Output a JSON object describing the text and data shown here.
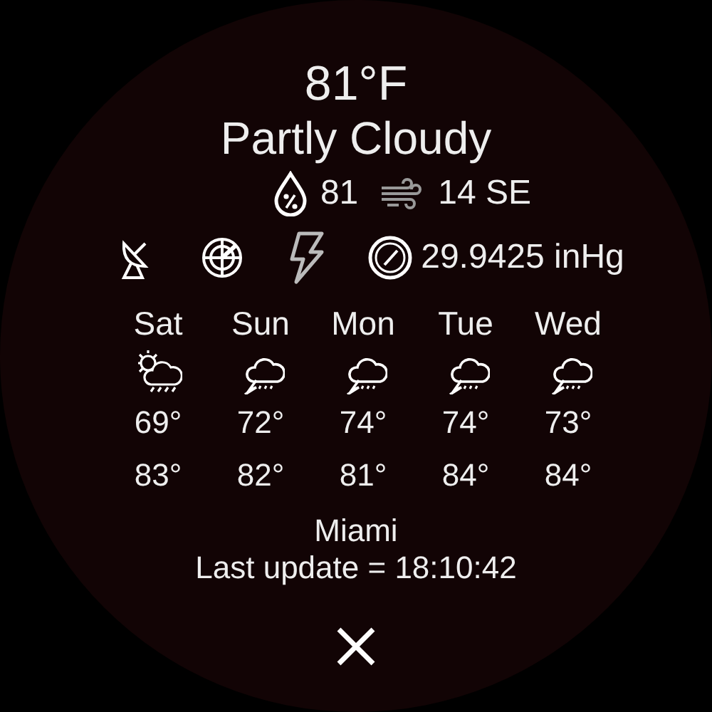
{
  "temperature": "81°F",
  "condition": "Partly Cloudy",
  "humidity": "81",
  "wind": "14 SE",
  "pressure": "29.9425 inHg",
  "forecast": [
    {
      "day": "Sat",
      "kind": "sun-rain",
      "low": "69°",
      "high": "83°"
    },
    {
      "day": "Sun",
      "kind": "storm",
      "low": "72°",
      "high": "82°"
    },
    {
      "day": "Mon",
      "kind": "storm",
      "low": "74°",
      "high": "81°"
    },
    {
      "day": "Tue",
      "kind": "storm",
      "low": "74°",
      "high": "84°"
    },
    {
      "day": "Wed",
      "kind": "storm",
      "low": "73°",
      "high": "84°"
    }
  ],
  "location": "Miami",
  "last_update": "Last update = 18:10:42"
}
